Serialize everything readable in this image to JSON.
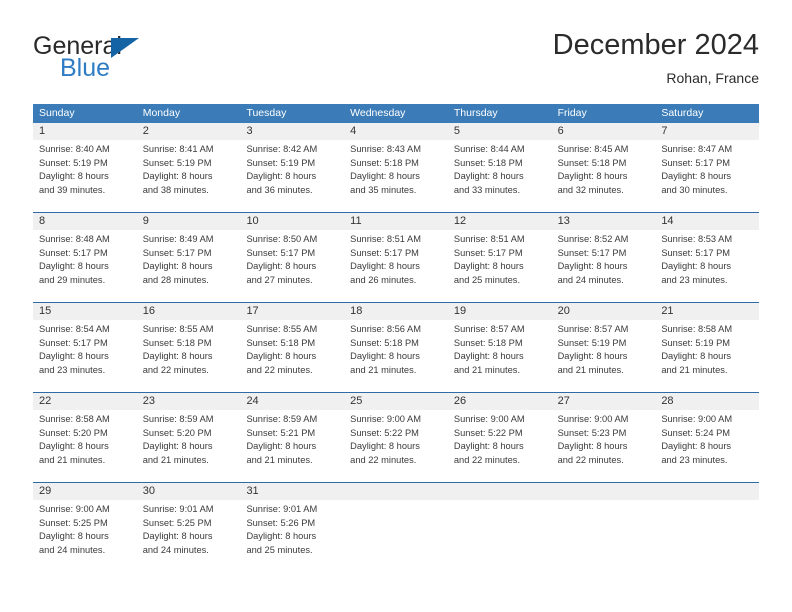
{
  "brand": {
    "name_part1": "General",
    "name_part2": "Blue",
    "accent_color": "#2e7cc4",
    "triangle_color": "#1464a5"
  },
  "header": {
    "title": "December 2024",
    "subtitle": "Rohan, France"
  },
  "calendar": {
    "header_bg": "#3b7cb8",
    "row_divider": "#2f6ca6",
    "daynum_bg": "#f0f0f0",
    "weekdays": [
      "Sunday",
      "Monday",
      "Tuesday",
      "Wednesday",
      "Thursday",
      "Friday",
      "Saturday"
    ],
    "weeks": [
      [
        {
          "day": "1",
          "sunrise": "Sunrise: 8:40 AM",
          "sunset": "Sunset: 5:19 PM",
          "daylight1": "Daylight: 8 hours",
          "daylight2": "and 39 minutes."
        },
        {
          "day": "2",
          "sunrise": "Sunrise: 8:41 AM",
          "sunset": "Sunset: 5:19 PM",
          "daylight1": "Daylight: 8 hours",
          "daylight2": "and 38 minutes."
        },
        {
          "day": "3",
          "sunrise": "Sunrise: 8:42 AM",
          "sunset": "Sunset: 5:19 PM",
          "daylight1": "Daylight: 8 hours",
          "daylight2": "and 36 minutes."
        },
        {
          "day": "4",
          "sunrise": "Sunrise: 8:43 AM",
          "sunset": "Sunset: 5:18 PM",
          "daylight1": "Daylight: 8 hours",
          "daylight2": "and 35 minutes."
        },
        {
          "day": "5",
          "sunrise": "Sunrise: 8:44 AM",
          "sunset": "Sunset: 5:18 PM",
          "daylight1": "Daylight: 8 hours",
          "daylight2": "and 33 minutes."
        },
        {
          "day": "6",
          "sunrise": "Sunrise: 8:45 AM",
          "sunset": "Sunset: 5:18 PM",
          "daylight1": "Daylight: 8 hours",
          "daylight2": "and 32 minutes."
        },
        {
          "day": "7",
          "sunrise": "Sunrise: 8:47 AM",
          "sunset": "Sunset: 5:17 PM",
          "daylight1": "Daylight: 8 hours",
          "daylight2": "and 30 minutes."
        }
      ],
      [
        {
          "day": "8",
          "sunrise": "Sunrise: 8:48 AM",
          "sunset": "Sunset: 5:17 PM",
          "daylight1": "Daylight: 8 hours",
          "daylight2": "and 29 minutes."
        },
        {
          "day": "9",
          "sunrise": "Sunrise: 8:49 AM",
          "sunset": "Sunset: 5:17 PM",
          "daylight1": "Daylight: 8 hours",
          "daylight2": "and 28 minutes."
        },
        {
          "day": "10",
          "sunrise": "Sunrise: 8:50 AM",
          "sunset": "Sunset: 5:17 PM",
          "daylight1": "Daylight: 8 hours",
          "daylight2": "and 27 minutes."
        },
        {
          "day": "11",
          "sunrise": "Sunrise: 8:51 AM",
          "sunset": "Sunset: 5:17 PM",
          "daylight1": "Daylight: 8 hours",
          "daylight2": "and 26 minutes."
        },
        {
          "day": "12",
          "sunrise": "Sunrise: 8:51 AM",
          "sunset": "Sunset: 5:17 PM",
          "daylight1": "Daylight: 8 hours",
          "daylight2": "and 25 minutes."
        },
        {
          "day": "13",
          "sunrise": "Sunrise: 8:52 AM",
          "sunset": "Sunset: 5:17 PM",
          "daylight1": "Daylight: 8 hours",
          "daylight2": "and 24 minutes."
        },
        {
          "day": "14",
          "sunrise": "Sunrise: 8:53 AM",
          "sunset": "Sunset: 5:17 PM",
          "daylight1": "Daylight: 8 hours",
          "daylight2": "and 23 minutes."
        }
      ],
      [
        {
          "day": "15",
          "sunrise": "Sunrise: 8:54 AM",
          "sunset": "Sunset: 5:17 PM",
          "daylight1": "Daylight: 8 hours",
          "daylight2": "and 23 minutes."
        },
        {
          "day": "16",
          "sunrise": "Sunrise: 8:55 AM",
          "sunset": "Sunset: 5:18 PM",
          "daylight1": "Daylight: 8 hours",
          "daylight2": "and 22 minutes."
        },
        {
          "day": "17",
          "sunrise": "Sunrise: 8:55 AM",
          "sunset": "Sunset: 5:18 PM",
          "daylight1": "Daylight: 8 hours",
          "daylight2": "and 22 minutes."
        },
        {
          "day": "18",
          "sunrise": "Sunrise: 8:56 AM",
          "sunset": "Sunset: 5:18 PM",
          "daylight1": "Daylight: 8 hours",
          "daylight2": "and 21 minutes."
        },
        {
          "day": "19",
          "sunrise": "Sunrise: 8:57 AM",
          "sunset": "Sunset: 5:18 PM",
          "daylight1": "Daylight: 8 hours",
          "daylight2": "and 21 minutes."
        },
        {
          "day": "20",
          "sunrise": "Sunrise: 8:57 AM",
          "sunset": "Sunset: 5:19 PM",
          "daylight1": "Daylight: 8 hours",
          "daylight2": "and 21 minutes."
        },
        {
          "day": "21",
          "sunrise": "Sunrise: 8:58 AM",
          "sunset": "Sunset: 5:19 PM",
          "daylight1": "Daylight: 8 hours",
          "daylight2": "and 21 minutes."
        }
      ],
      [
        {
          "day": "22",
          "sunrise": "Sunrise: 8:58 AM",
          "sunset": "Sunset: 5:20 PM",
          "daylight1": "Daylight: 8 hours",
          "daylight2": "and 21 minutes."
        },
        {
          "day": "23",
          "sunrise": "Sunrise: 8:59 AM",
          "sunset": "Sunset: 5:20 PM",
          "daylight1": "Daylight: 8 hours",
          "daylight2": "and 21 minutes."
        },
        {
          "day": "24",
          "sunrise": "Sunrise: 8:59 AM",
          "sunset": "Sunset: 5:21 PM",
          "daylight1": "Daylight: 8 hours",
          "daylight2": "and 21 minutes."
        },
        {
          "day": "25",
          "sunrise": "Sunrise: 9:00 AM",
          "sunset": "Sunset: 5:22 PM",
          "daylight1": "Daylight: 8 hours",
          "daylight2": "and 22 minutes."
        },
        {
          "day": "26",
          "sunrise": "Sunrise: 9:00 AM",
          "sunset": "Sunset: 5:22 PM",
          "daylight1": "Daylight: 8 hours",
          "daylight2": "and 22 minutes."
        },
        {
          "day": "27",
          "sunrise": "Sunrise: 9:00 AM",
          "sunset": "Sunset: 5:23 PM",
          "daylight1": "Daylight: 8 hours",
          "daylight2": "and 22 minutes."
        },
        {
          "day": "28",
          "sunrise": "Sunrise: 9:00 AM",
          "sunset": "Sunset: 5:24 PM",
          "daylight1": "Daylight: 8 hours",
          "daylight2": "and 23 minutes."
        }
      ],
      [
        {
          "day": "29",
          "sunrise": "Sunrise: 9:00 AM",
          "sunset": "Sunset: 5:25 PM",
          "daylight1": "Daylight: 8 hours",
          "daylight2": "and 24 minutes."
        },
        {
          "day": "30",
          "sunrise": "Sunrise: 9:01 AM",
          "sunset": "Sunset: 5:25 PM",
          "daylight1": "Daylight: 8 hours",
          "daylight2": "and 24 minutes."
        },
        {
          "day": "31",
          "sunrise": "Sunrise: 9:01 AM",
          "sunset": "Sunset: 5:26 PM",
          "daylight1": "Daylight: 8 hours",
          "daylight2": "and 25 minutes."
        },
        {
          "day": "",
          "sunrise": "",
          "sunset": "",
          "daylight1": "",
          "daylight2": ""
        },
        {
          "day": "",
          "sunrise": "",
          "sunset": "",
          "daylight1": "",
          "daylight2": ""
        },
        {
          "day": "",
          "sunrise": "",
          "sunset": "",
          "daylight1": "",
          "daylight2": ""
        },
        {
          "day": "",
          "sunrise": "",
          "sunset": "",
          "daylight1": "",
          "daylight2": ""
        }
      ]
    ]
  }
}
